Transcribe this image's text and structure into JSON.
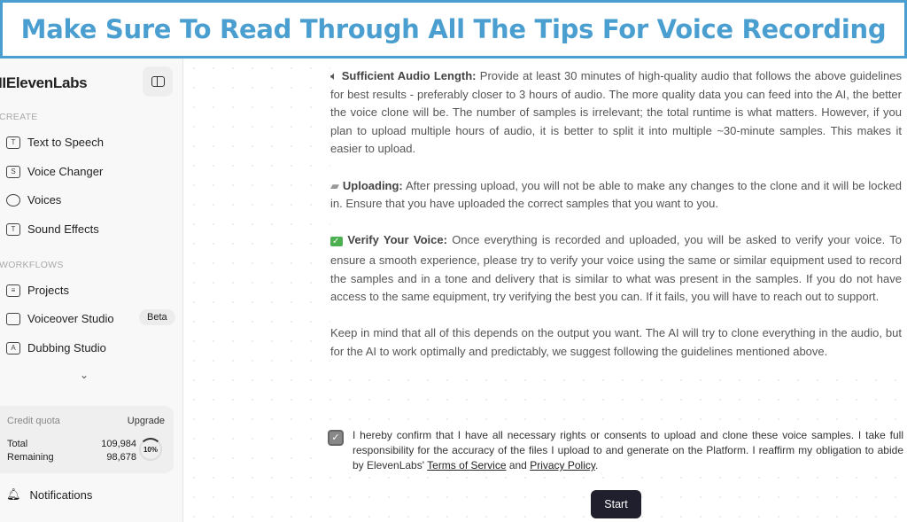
{
  "banner": {
    "title": "Make Sure To Read Through All The Tips For Voice Recording"
  },
  "sidebar": {
    "logo": "IIElevenLabs",
    "create_label": "CREATE",
    "create_items": [
      {
        "label": "Text to Speech",
        "icon": "text-to-speech-icon"
      },
      {
        "label": "Voice Changer",
        "icon": "voice-changer-icon"
      },
      {
        "label": "Voices",
        "icon": "voices-icon"
      },
      {
        "label": "Sound Effects",
        "icon": "sound-effects-icon"
      }
    ],
    "workflows_label": "WORKFLOWS",
    "workflow_items": [
      {
        "label": "Projects"
      },
      {
        "label": "Voiceover Studio",
        "badge": "Beta"
      },
      {
        "label": "Dubbing Studio"
      }
    ],
    "quota": {
      "title": "Credit quota",
      "upgrade": "Upgrade",
      "total_label": "Total",
      "total": "109,984",
      "remaining_label": "Remaining",
      "remaining": "98,678",
      "percent": "10%"
    },
    "notifications": "Notifications"
  },
  "main": {
    "p1_title": "Sufficient Audio Length:",
    "p1_body": " Provide at least 30 minutes of high-quality audio that follows the above guidelines for best results - preferably closer to 3 hours of audio. The more quality data you can feed into the AI, the better the voice clone will be. The number of samples is irrelevant; the total runtime is what matters. However, if you plan to upload multiple hours of audio, it is better to split it into multiple ~30-minute samples. This makes it easier to upload.",
    "p2_title": "Uploading:",
    "p2_body": " After pressing upload, you will not be able to make any changes to the clone and it will be locked in. Ensure that you have uploaded the correct samples that you want to you.",
    "p3_title": "Verify Your Voice:",
    "p3_body": " Once everything is recorded and uploaded, you will be asked to verify your voice. To ensure a smooth experience, please try to verify your voice using the same or similar equipment used to record the samples and in a tone and delivery that is similar to what was present in the samples. If you do not have access to the same equipment, try verifying the best you can. If it fails, you will have to reach out to support.",
    "p4": "Keep in mind that all of this depends on the output you want. The AI will try to clone everything in the audio, but for the AI to work optimally and predictably, we suggest following the guidelines mentioned above.",
    "consent_text": "I hereby confirm that I have all necessary rights or consents to upload and clone these voice samples. I take full responsibility for the accuracy of the files I upload to and generate on the Platform. I reaffirm my obligation to abide by ElevenLabs' ",
    "terms": "Terms of Service",
    "and": " and ",
    "privacy": "Privacy Policy",
    "period": ".",
    "consent_checked": true,
    "start": "Start"
  }
}
